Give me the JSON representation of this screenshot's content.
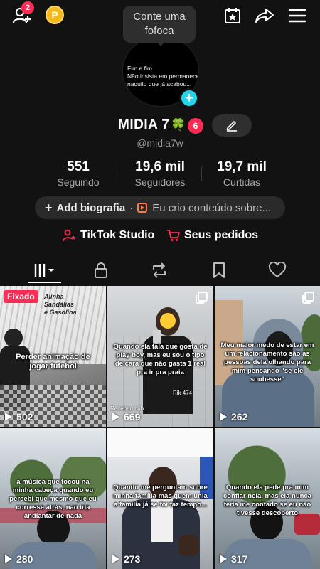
{
  "topbar": {
    "add_friends_badge": "2",
    "coin_label": "P"
  },
  "note": {
    "bubble_text": "Conte uma fofoca",
    "avatar_text": "Fim e fim.\nNão insista em permanecer naquilo que já acabou..."
  },
  "profile": {
    "name": "MIDIA 7",
    "emoji": "🍀",
    "name_badge": "6",
    "handle": "@midia7w"
  },
  "stats": [
    {
      "value": "551",
      "label": "Seguindo"
    },
    {
      "value": "19,6 mil",
      "label": "Seguidores"
    },
    {
      "value": "19,7 mil",
      "label": "Curtidas"
    }
  ],
  "bio": {
    "add_label": "Add biografia",
    "separator": "·",
    "creator_text": "Eu crio conteúdo sobre..."
  },
  "links": {
    "studio": "TikTok Studio",
    "orders": "Seus pedidos"
  },
  "videos": [
    {
      "pinned_label": "Fixado",
      "caption": "Perder animação de jogar futebol",
      "views": "502",
      "sign_text": "Alinha Sandálias e Gasolina",
      "multi": false
    },
    {
      "caption": "Quando ela fala que gosta de play boy, mas eu sou o tipo de cara que não gasta 1 real pra ir pra praia",
      "views": "669",
      "sticker": "Rik 474",
      "sticker2": "Recebeu crih...",
      "multi": true
    },
    {
      "caption": "Meu maior medo de estar em um relacionamento são as pessoas dela olhando para mim pensando \"se ele soubesse\"",
      "views": "262",
      "multi": true
    },
    {
      "caption": "a música que tocou na minha cabeça quando eu percebi que mesmo que eu corresse atrás, não iria andiantar de nada",
      "views": "280",
      "multi": false
    },
    {
      "caption": "Quando me perguntam sobre minha família mas quem unia a família já se foi faz tempo...",
      "views": "273",
      "multi": false
    },
    {
      "caption": "Quando ela pede pra mim confiar nela, mas ela nunca teria me contado se eu não tivesse descoberto",
      "views": "317",
      "multi": false
    }
  ],
  "colors": {
    "accent_red": "#fe2c55",
    "accent_cyan": "#20d5ec",
    "background": "#121212"
  },
  "icons": [
    "add-friend-icon",
    "coin-icon",
    "calendar-star-icon",
    "share-icon",
    "menu-icon",
    "pencil-icon",
    "tiktok-studio-icon",
    "cart-icon",
    "grid-icon",
    "lock-icon",
    "repost-icon",
    "bookmark-icon",
    "heart-icon",
    "play-icon"
  ]
}
